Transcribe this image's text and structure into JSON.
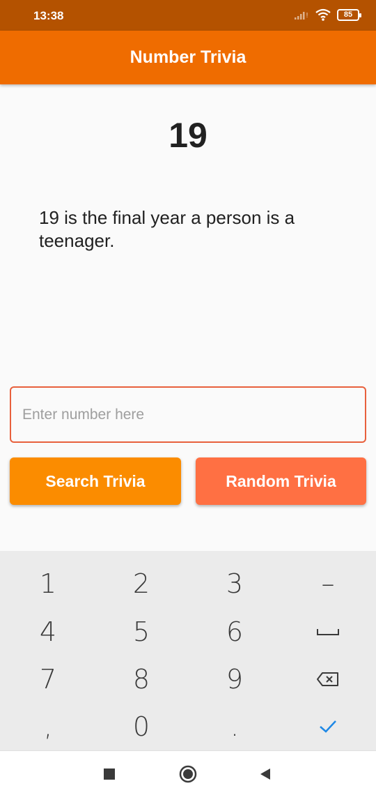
{
  "status_bar": {
    "time": "13:38",
    "battery": "85"
  },
  "app_bar": {
    "title": "Number Trivia"
  },
  "trivia": {
    "number": "19",
    "text": "19 is the final year a person is a teenager."
  },
  "search": {
    "placeholder": "Enter number here",
    "value": ""
  },
  "buttons": {
    "search_label": "Search Trivia",
    "random_label": "Random Trivia"
  },
  "keyboard": {
    "keys": [
      "1",
      "2",
      "3",
      "–",
      "4",
      "5",
      "6",
      "space",
      "7",
      "8",
      "9",
      "backspace",
      ",",
      "0",
      ".",
      "done"
    ]
  },
  "colors": {
    "status_bar": "#b45200",
    "app_bar": "#ef6c00",
    "search_button": "#fb8c00",
    "random_button": "#ff7043",
    "input_border": "#e8603c",
    "check_icon": "#1e88e5"
  }
}
